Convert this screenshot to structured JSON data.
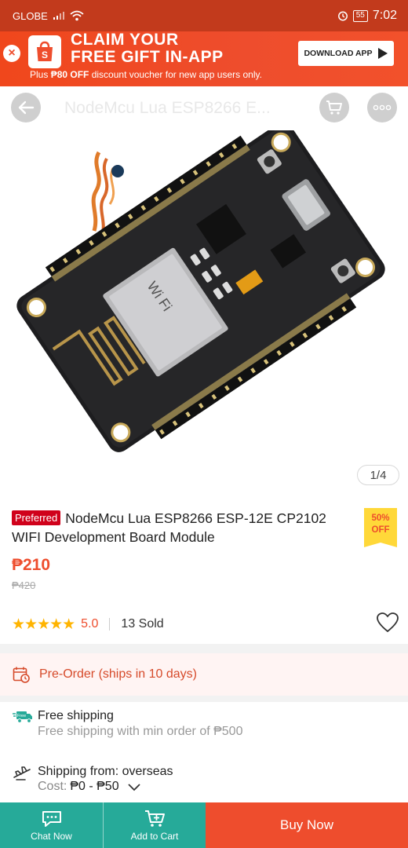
{
  "status_bar": {
    "carrier": "GLOBE",
    "battery": "55",
    "time": "7:02"
  },
  "promo": {
    "title_line1": "CLAIM YOUR",
    "title_line2": "FREE GIFT IN-APP",
    "subtitle_prefix": "Plus ",
    "subtitle_bold": "₱80 OFF",
    "subtitle_rest": " discount voucher for new app users only.",
    "button_label": "DOWNLOAD APP",
    "logo_letter": "S"
  },
  "nav": {
    "title": "NodeMcu Lua ESP8266 E..."
  },
  "image": {
    "counter": "1/4"
  },
  "product": {
    "badge": "Preferred",
    "name": "NodeMcu Lua ESP8266 ESP-12E CP2102 WIFI Development Board Module",
    "discount_pct": "50%",
    "discount_word": "OFF",
    "price": "₱210",
    "old_price": "₱420",
    "stars": "★★★★★",
    "rating": "5.0",
    "sold": "13 Sold"
  },
  "preorder": {
    "label": "Pre-Order (ships in 10 days)"
  },
  "shipping": {
    "free_icon_label": "Free",
    "free_title": "Free shipping",
    "free_sub": "Free shipping with min order of ₱500",
    "from_label": "Shipping from: ",
    "from_value": "overseas",
    "cost_label": "Cost: ",
    "cost_value": "₱0 - ₱50"
  },
  "bottom_bar": {
    "chat": "Chat Now",
    "cart": "Add to Cart",
    "buy": "Buy Now"
  },
  "colors": {
    "brand": "#ee4d2d",
    "teal": "#26aa99",
    "star": "#ffb400",
    "statusbar": "#c23a1c"
  }
}
